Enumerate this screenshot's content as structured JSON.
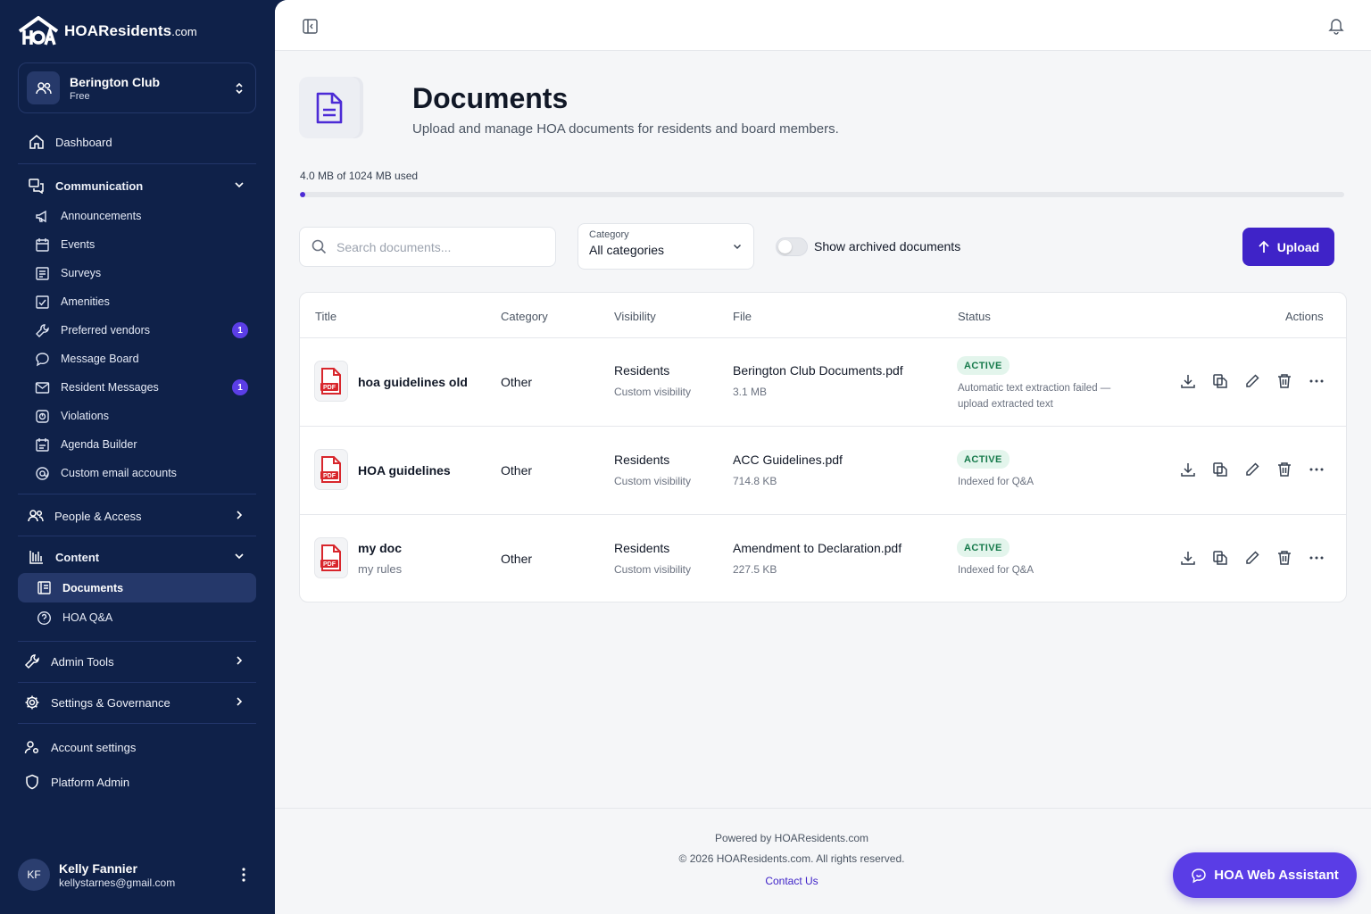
{
  "brand": {
    "name": "HOAResidents",
    "domain": ".com"
  },
  "org": {
    "name": "Berington Club",
    "plan": "Free"
  },
  "nav": {
    "dashboard": "Dashboard",
    "communication": {
      "label": "Communication",
      "items": [
        {
          "label": "Announcements",
          "icon": "megaphone-icon"
        },
        {
          "label": "Events",
          "icon": "calendar-icon"
        },
        {
          "label": "Surveys",
          "icon": "survey-icon"
        },
        {
          "label": "Amenities",
          "icon": "checkbox-icon"
        },
        {
          "label": "Preferred vendors",
          "icon": "wrench-icon",
          "badge": "1"
        },
        {
          "label": "Message Board",
          "icon": "chat-icon"
        },
        {
          "label": "Resident Messages",
          "icon": "mail-icon",
          "badge": "1"
        },
        {
          "label": "Violations",
          "icon": "violation-icon"
        },
        {
          "label": "Agenda Builder",
          "icon": "agenda-icon"
        },
        {
          "label": "Custom email accounts",
          "icon": "at-icon"
        }
      ]
    },
    "people": "People & Access",
    "content": {
      "label": "Content",
      "items": [
        {
          "label": "Documents",
          "icon": "document-icon",
          "active": true
        },
        {
          "label": "HOA Q&A",
          "icon": "qa-icon"
        }
      ]
    },
    "admin_tools": "Admin Tools",
    "settings": "Settings & Governance",
    "account_settings": "Account settings",
    "platform_admin": "Platform Admin"
  },
  "user": {
    "initials": "KF",
    "name": "Kelly Fannier",
    "email": "kellystarnes@gmail.com"
  },
  "page": {
    "title": "Documents",
    "subtitle": "Upload and manage HOA documents for residents and board members."
  },
  "storage": {
    "label": "4.0 MB of 1024 MB used",
    "used_fraction": 0.0039
  },
  "search": {
    "placeholder": "Search documents..."
  },
  "category_filter": {
    "label": "Category",
    "value": "All categories"
  },
  "archived_toggle": {
    "label": "Show archived documents",
    "on": false
  },
  "upload_label": "Upload",
  "table": {
    "headers": {
      "title": "Title",
      "category": "Category",
      "visibility": "Visibility",
      "file": "File",
      "status": "Status",
      "actions": "Actions"
    },
    "rows": [
      {
        "title": "hoa guidelines old",
        "subtitle": "",
        "category": "Other",
        "visibility": "Residents",
        "visibility_sub": "Custom visibility",
        "file": "Berington Club Documents.pdf",
        "size": "3.1 MB",
        "status": "ACTIVE",
        "status_note": "Automatic text extraction failed — upload extracted text"
      },
      {
        "title": "HOA guidelines",
        "subtitle": "",
        "category": "Other",
        "visibility": "Residents",
        "visibility_sub": "Custom visibility",
        "file": "ACC Guidelines.pdf",
        "size": "714.8 KB",
        "status": "ACTIVE",
        "status_note": "Indexed for Q&A"
      },
      {
        "title": "my doc",
        "subtitle": "my rules",
        "category": "Other",
        "visibility": "Residents",
        "visibility_sub": "Custom visibility",
        "file": "Amendment to Declaration.pdf",
        "size": "227.5 KB",
        "status": "ACTIVE",
        "status_note": "Indexed for Q&A"
      }
    ]
  },
  "pdf_badge": "PDF",
  "footer": {
    "powered": "Powered by HOAResidents.com",
    "copyright": "© 2026 HOAResidents.com. All rights reserved.",
    "contact": "Contact Us"
  },
  "assistant_label": "HOA Web Assistant",
  "colors": {
    "sidebar": "#0f2149",
    "accent": "#3f23c8",
    "assistant": "#5a3de6",
    "active_status": "#167a4b"
  }
}
